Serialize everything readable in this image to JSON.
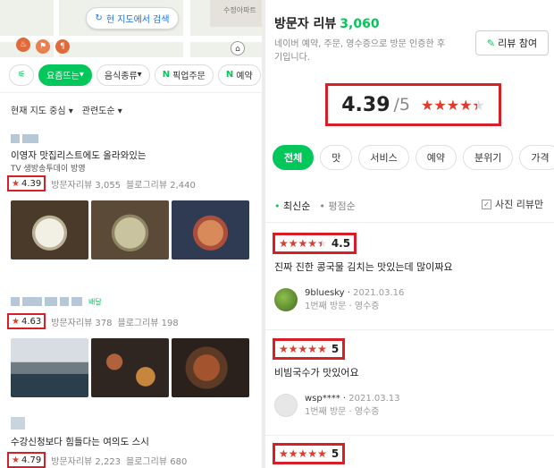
{
  "map": {
    "search_label": "현 지도에서 검색",
    "apt_label": "수정아파트"
  },
  "filters": {
    "chips": [
      {
        "label": "요즘뜨는",
        "arrow": "▾"
      },
      {
        "label": "음식종류",
        "arrow": "▾"
      },
      {
        "label": "픽업주문",
        "prefix": "N"
      },
      {
        "label": "예약",
        "prefix": "N"
      }
    ]
  },
  "sorts": {
    "area": "현재 지도 중심",
    "relevance": "관련도순"
  },
  "restaurants": [
    {
      "title": "이영자 맛집리스트에도 올라와있는",
      "tv": "TV  생방송투데이 방영",
      "rating": "4.39",
      "visitor_reviews": "방문자리뷰 3,055",
      "blog_reviews": "블로그리뷰 2,440"
    },
    {
      "title": "",
      "badge": "배달",
      "rating": "4.63",
      "visitor_reviews": "방문자리뷰 378",
      "blog_reviews": "블로그리뷰 198"
    },
    {
      "title": "수강신청보다 힘들다는 여의도 스시",
      "rating": "4.79",
      "visitor_reviews": "방문자리뷰 2,223",
      "blog_reviews": "블로그리뷰 680"
    }
  ],
  "review_panel": {
    "title": "방문자 리뷰",
    "count": "3,060",
    "description": "네이버 예약, 주문, 영수증으로 방문 인증한 후기입니다.",
    "write_button": "리뷰 참여",
    "score": "4.39",
    "score_den": "/5",
    "stars_value": 4.39,
    "tabs": [
      "전체",
      "맛",
      "서비스",
      "예약",
      "분위기",
      "가격"
    ],
    "sort_latest": "최신순",
    "sort_rating": "평점순",
    "photo_only": "사진 리뷰만",
    "colors": {
      "accent": "#03c75a",
      "star": "#e03c2e",
      "highlight": "#d61f26"
    }
  },
  "reviews": [
    {
      "score": "4.5",
      "stars_value": 4.5,
      "text": "진짜 진한 콩국물 김치는 맛있는데 많이짜요",
      "user": "9bluesky",
      "date": "2021.03.16",
      "visit": "1번째 방문",
      "proof": "영수증"
    },
    {
      "score": "5",
      "stars_value": 5,
      "text": "비빔국수가 맛있어요",
      "user": "wsp****",
      "date": "2021.03.13",
      "visit": "1번째 방문",
      "proof": "영수증"
    },
    {
      "score": "5",
      "stars_value": 5
    }
  ]
}
